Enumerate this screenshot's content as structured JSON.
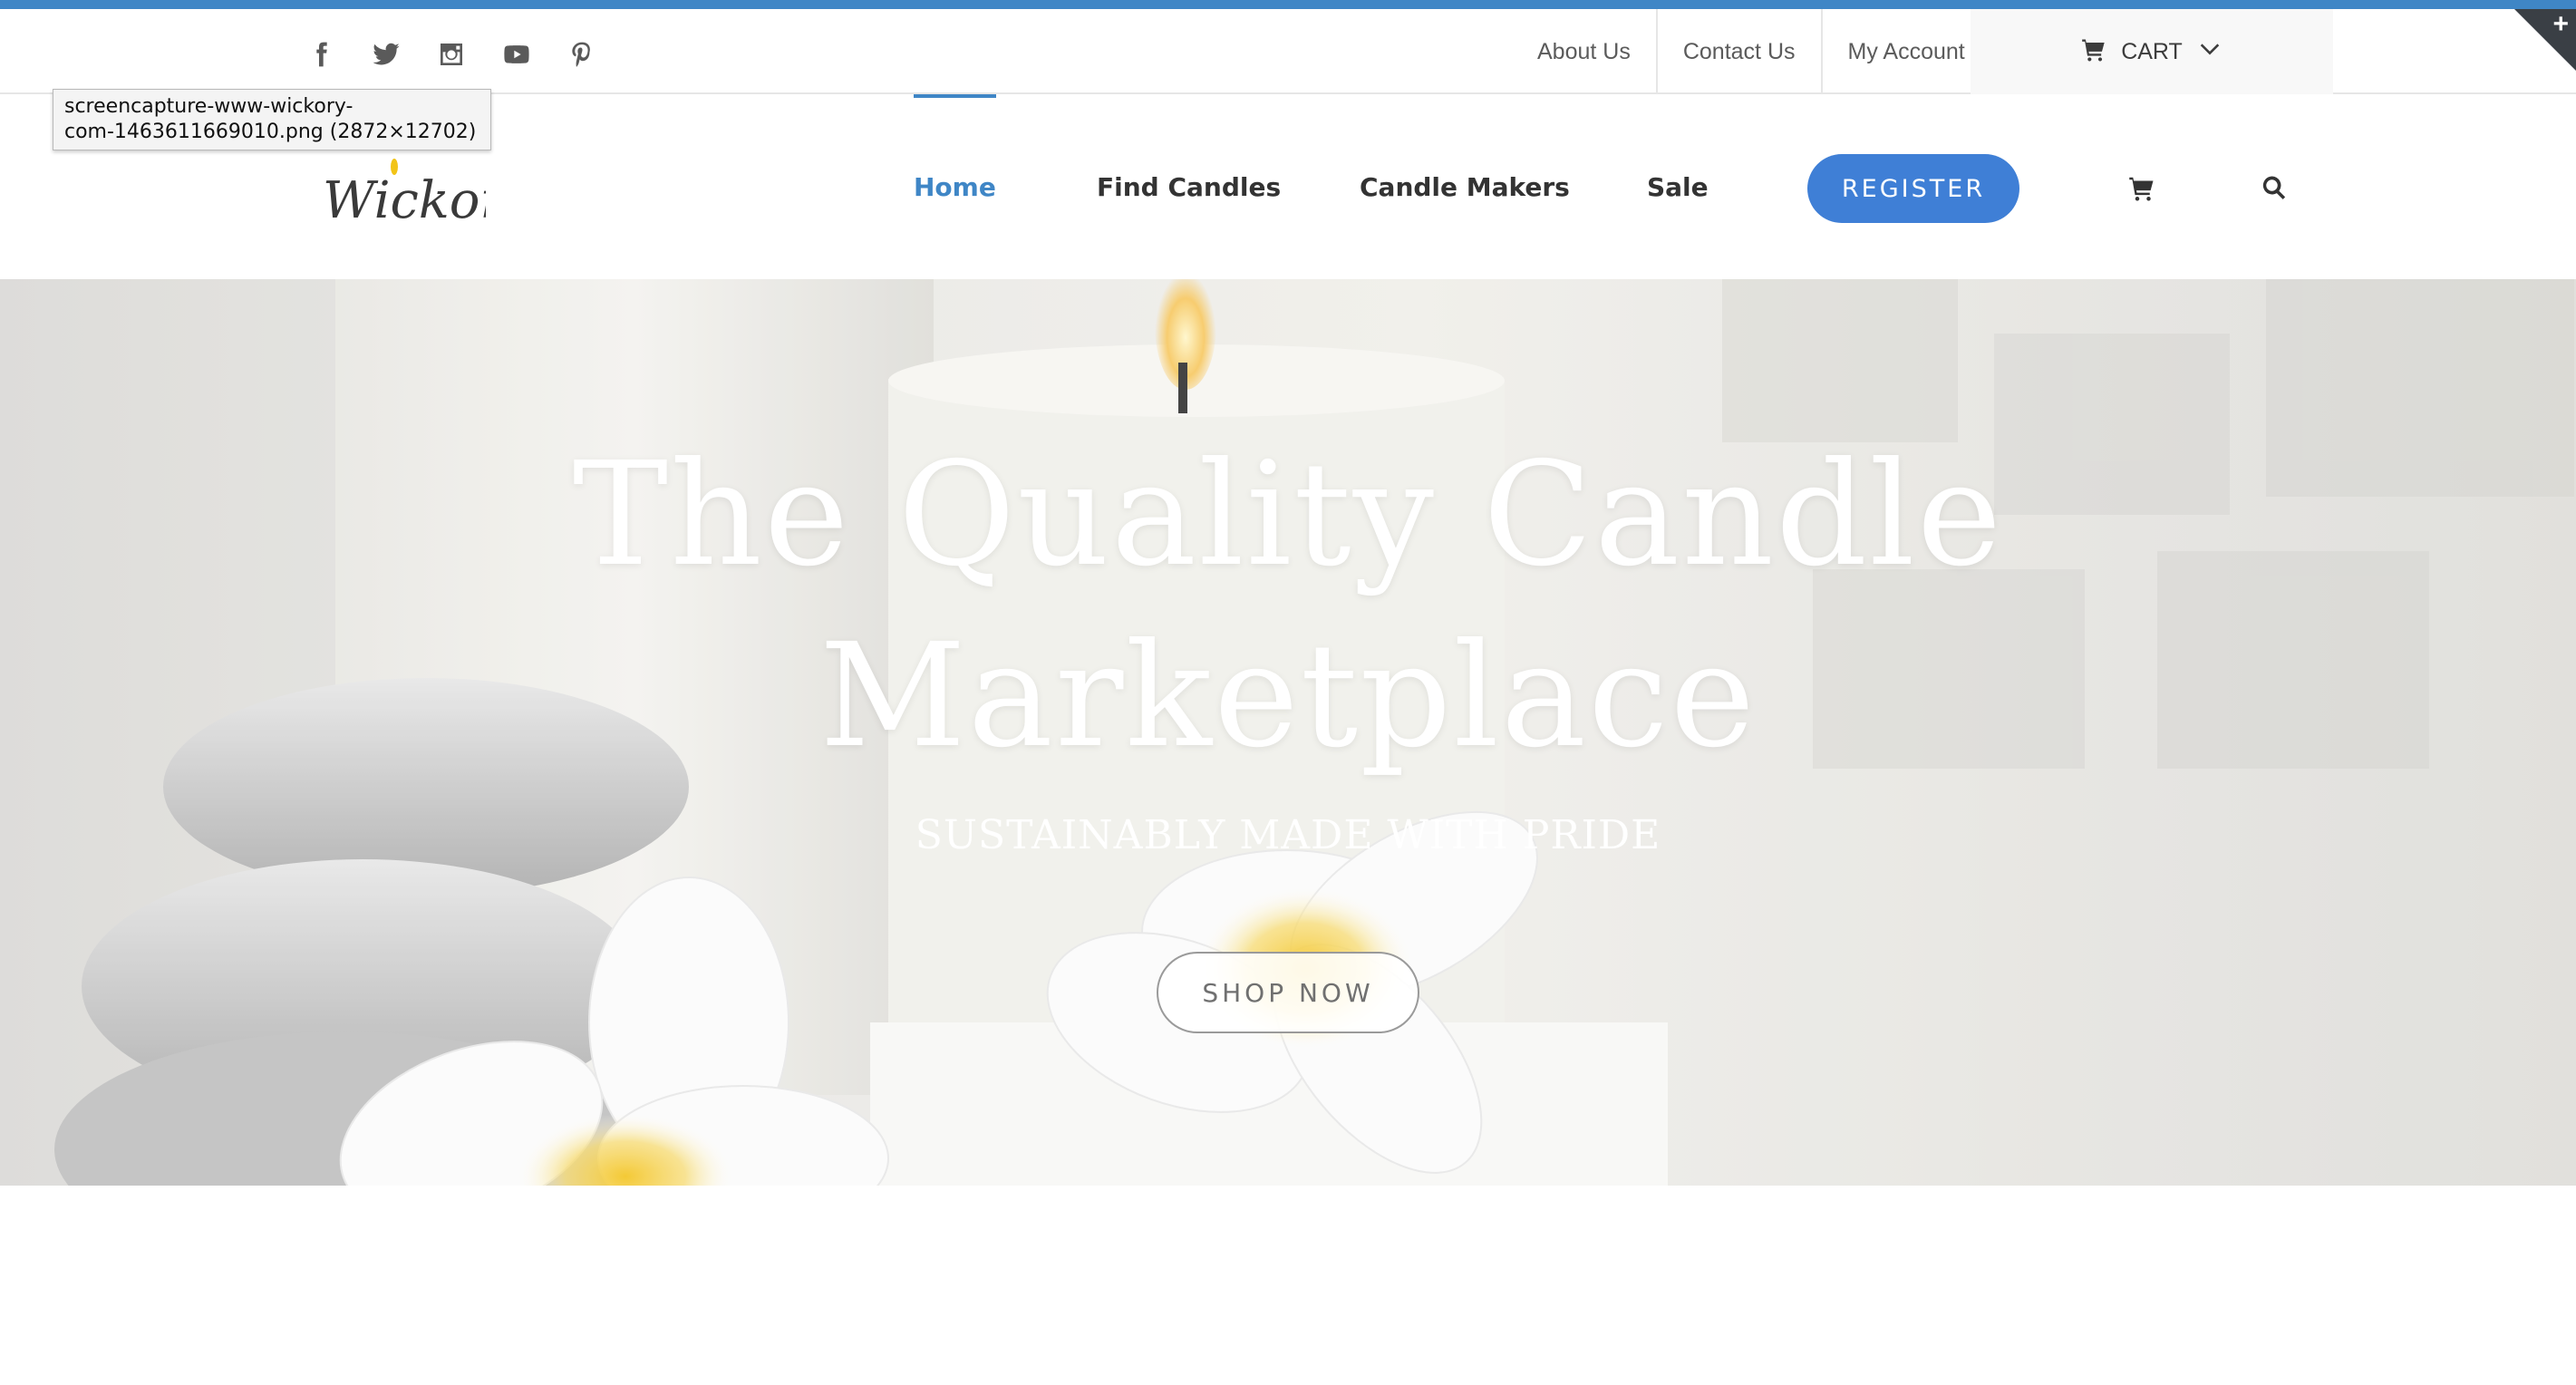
{
  "tooltip": {
    "line1": "screencapture-www-wickory-",
    "line2": "com-1463611669010.png (2872×12702)"
  },
  "social_icons": [
    "facebook-icon",
    "twitter-icon",
    "instagram-icon",
    "youtube-icon",
    "pinterest-icon"
  ],
  "top_links": {
    "about": "About Us",
    "contact": "Contact Us",
    "account": "My Account",
    "cart": "CART"
  },
  "logo": {
    "text": "Wickory"
  },
  "nav": {
    "home": "Home",
    "find_candles": "Find Candles",
    "candle_makers": "Candle Makers",
    "sale": "Sale",
    "register": "REGISTER"
  },
  "hero": {
    "title_line1": "The Quality Candle",
    "title_line2": "Marketplace",
    "subtitle": "SUSTAINABLY MADE WITH PRIDE",
    "cta": "SHOP NOW"
  },
  "colors": {
    "accent": "#3f86c6",
    "register_bg": "#3f7fd6",
    "corner": "#3a3f45"
  }
}
